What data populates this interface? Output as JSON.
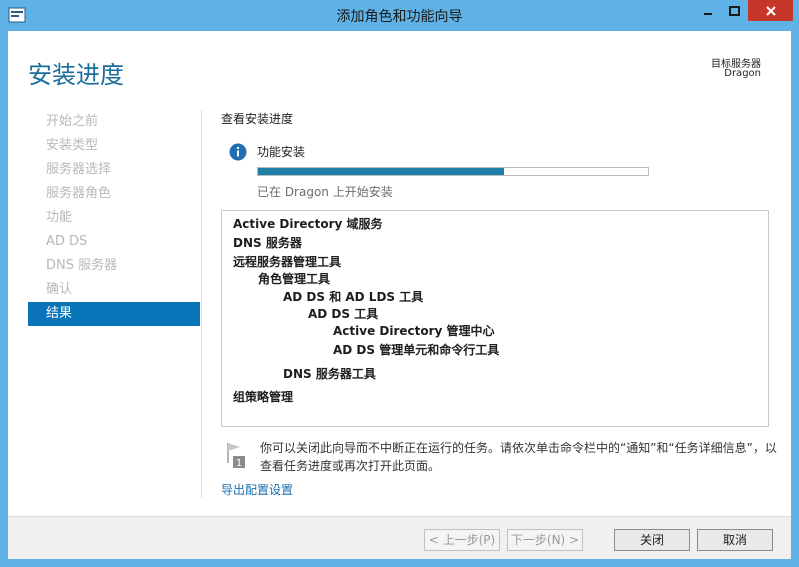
{
  "window": {
    "title": "添加角色和功能向导",
    "controls": {
      "minimize": "minimize-icon",
      "maximize": "maximize-icon",
      "close": "close-icon"
    }
  },
  "header": {
    "page_title": "安装进度",
    "target_label": "目标服务器",
    "target_name": "Dragon"
  },
  "nav": {
    "items": [
      {
        "label": "开始之前",
        "active": false
      },
      {
        "label": "安装类型",
        "active": false
      },
      {
        "label": "服务器选择",
        "active": false
      },
      {
        "label": "服务器角色",
        "active": false
      },
      {
        "label": "功能",
        "active": false
      },
      {
        "label": "AD DS",
        "active": false
      },
      {
        "label": "DNS 服务器",
        "active": false
      },
      {
        "label": "确认",
        "active": false
      },
      {
        "label": "结果",
        "active": true
      }
    ]
  },
  "main": {
    "section_title": "查看安装进度",
    "feature_label": "功能安装",
    "progress_fraction": 0.63,
    "progress_status": "已在 Dragon 上开始安装",
    "features": [
      {
        "label": "Active Directory 域服务",
        "level": 0
      },
      {
        "label": "DNS 服务器",
        "level": 0
      },
      {
        "label": "远程服务器管理工具",
        "level": 0
      },
      {
        "label": "角色管理工具",
        "level": 1
      },
      {
        "label": "AD DS 和 AD LDS 工具",
        "level": 2
      },
      {
        "label": "AD DS 工具",
        "level": 3
      },
      {
        "label": "Active Directory 管理中心",
        "level": 4
      },
      {
        "label": "AD DS 管理单元和命令行工具",
        "level": 4
      },
      {
        "label": "DNS 服务器工具",
        "level": 2
      },
      {
        "label": "组策略管理",
        "level": 0
      }
    ],
    "note_text": "你可以关闭此向导而不中断正在运行的任务。请依次单击命令栏中的“通知”和“任务详细信息”，以查看任务进度或再次打开此页面。",
    "export_link": "导出配置设置"
  },
  "footer": {
    "prev_label": "< 上一步(P)",
    "next_label": "下一步(N) >",
    "close_label": "关闭",
    "cancel_label": "取消"
  },
  "colors": {
    "titlebar": "#5fb2e6",
    "accent": "#1b6e9a",
    "nav_active": "#0a74b8",
    "progress": "#1f7fa9",
    "close_button": "#c7362b"
  }
}
